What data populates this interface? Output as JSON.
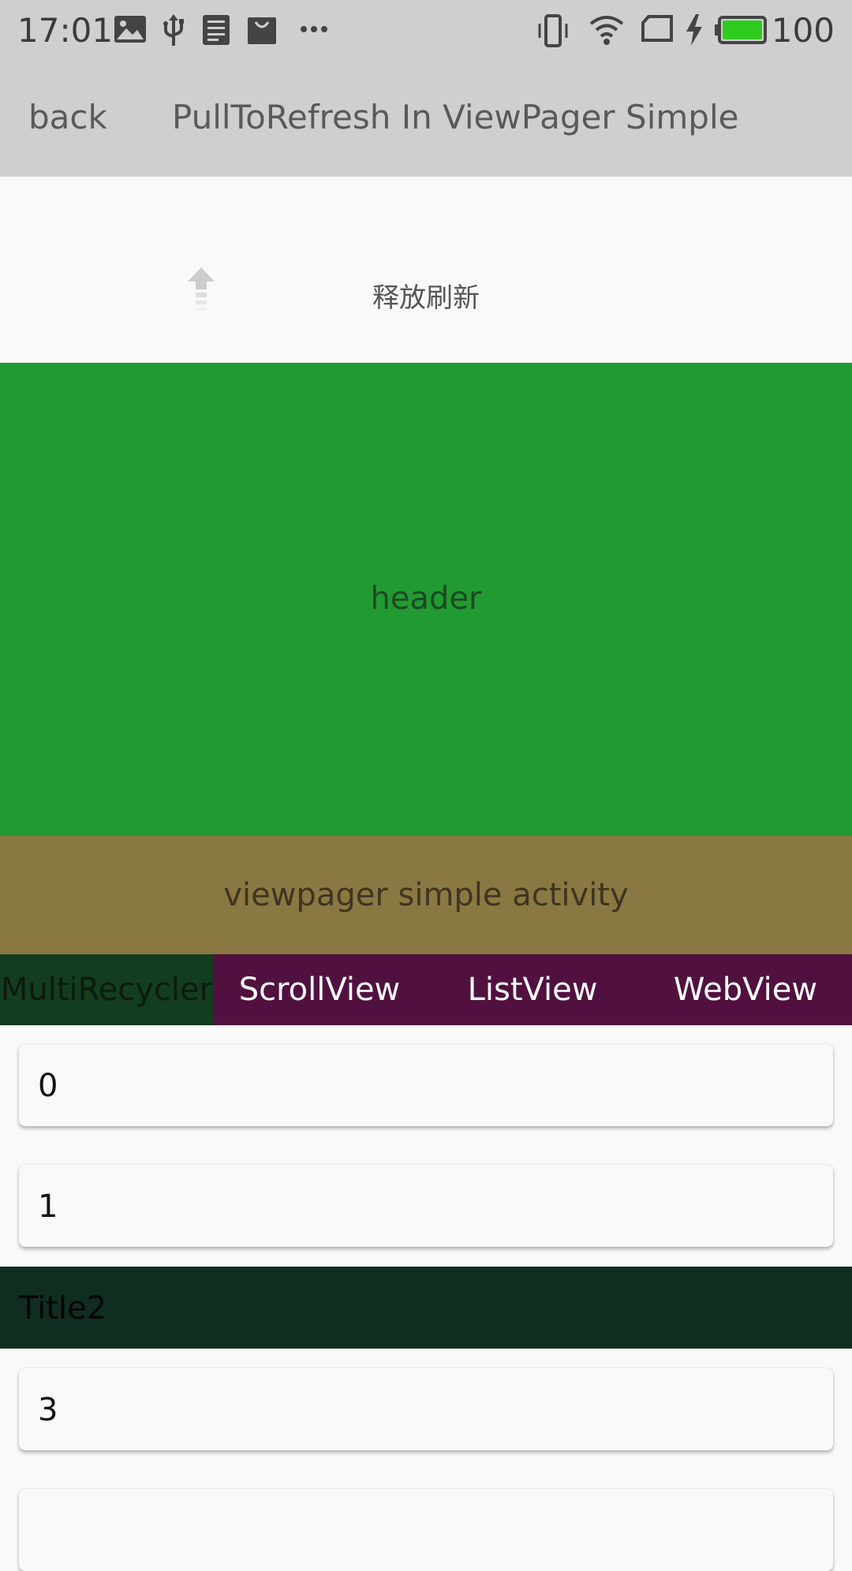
{
  "status_bar": {
    "time": "17:01",
    "battery_level": "100",
    "icons": [
      "image-icon",
      "usb-icon",
      "news-icon",
      "shopping-bag-icon",
      "more-dots-icon",
      "vibrate-icon",
      "wifi-icon",
      "sim-icon",
      "charging-icon",
      "battery-icon"
    ],
    "battery_color": "#2ecc1e"
  },
  "app_bar": {
    "back_label": "back",
    "title": "PullToRefresh In ViewPager Simple"
  },
  "refresh": {
    "label": "释放刷新"
  },
  "header": {
    "label": "header",
    "color": "#229a33"
  },
  "activity_bar": {
    "label": "viewpager simple activity",
    "color": "#8a7843"
  },
  "tabs": [
    {
      "label": "MultiRecycler",
      "active": true
    },
    {
      "label": "ScrollView",
      "active": false
    },
    {
      "label": "ListView",
      "active": false
    },
    {
      "label": "WebView",
      "active": false
    }
  ],
  "list": {
    "items": [
      {
        "label": "0"
      },
      {
        "label": "1"
      },
      {
        "label": "3"
      },
      {
        "label": ""
      }
    ],
    "section_title": "Title2"
  }
}
